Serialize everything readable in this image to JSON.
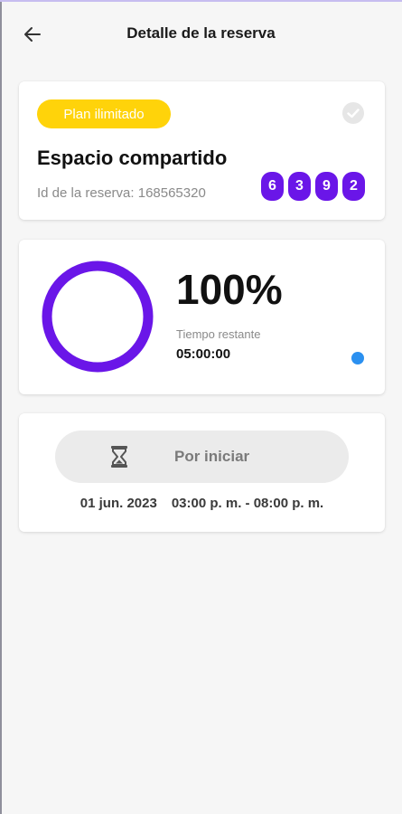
{
  "header": {
    "title": "Detalle de la reserva",
    "back_icon": "arrow-left-icon"
  },
  "reservation": {
    "plan_badge": "Plan ilimitado",
    "space_name": "Espacio compartido",
    "id_label": "Id de la reserva: 168565320",
    "code_digits": [
      "6",
      "3",
      "9",
      "2"
    ],
    "check_icon": "check-circle-icon"
  },
  "timer": {
    "progress_percent": 100,
    "percent_text": "100%",
    "label": "Tiempo restante",
    "value": "05:00:00"
  },
  "schedule": {
    "status_label": "Por iniciar",
    "status_icon": "hourglass-icon",
    "date": "01 jun. 2023",
    "time_range": "03:00 p. m. - 08:00 p. m."
  },
  "colors": {
    "accent": "#6a16e8",
    "badge": "#ffd30a",
    "status_dot": "#2b90f0"
  }
}
